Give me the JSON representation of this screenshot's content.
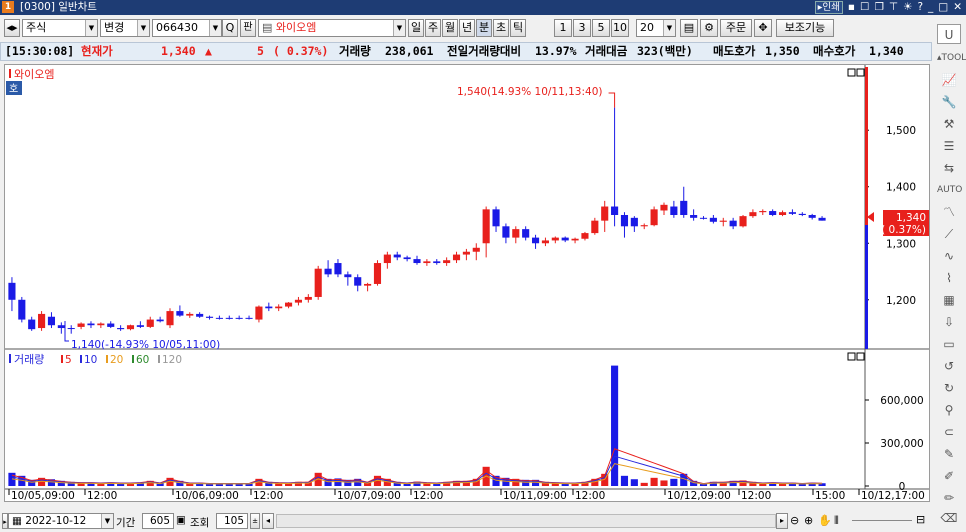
{
  "titlebar": {
    "app_icon": "1",
    "title": "[0300] 일반차트",
    "link": "▸인쇄",
    "icons": [
      "pin-icon",
      "window-icon",
      "window-icon",
      "pin-icon",
      "star-icon",
      "help-icon",
      "minimize-icon",
      "maximize-icon",
      "close-icon"
    ]
  },
  "toolbar": {
    "market": "주식",
    "change_label": "변경",
    "code": "066430",
    "search": "Q",
    "pan_label": "판",
    "stock_name": "와이오엠",
    "periods": [
      "일",
      "주",
      "월",
      "년",
      "분",
      "초",
      "틱"
    ],
    "active_period": "분",
    "minutes": [
      "1",
      "3",
      "5",
      "10"
    ],
    "count": "20",
    "order_label": "주문",
    "aux_label": "보조기능"
  },
  "pricebar": {
    "time": "[15:30:08]",
    "cur_label": "현재가",
    "price": "1,340",
    "arrow": "▲",
    "change": "5",
    "change_pct": "( 0.37%)",
    "vol_label": "거래량",
    "volume": "238,061",
    "prev_label": "전일거래량대비",
    "prev_ratio": "13.97%",
    "amt_label": "거래대금",
    "amount": "323(백만)",
    "ask_label": "매도호가",
    "ask": "1,350",
    "bid_label": "매수호가",
    "bid": "1,340"
  },
  "chart": {
    "title": "와이오엠",
    "badge": "호",
    "high_annotation": "1,540(14.93% 10/11,13:40)",
    "low_annotation": "1,140(-14.93% 10/05,11:00)",
    "price_ticks": [
      "1,500",
      "1,400",
      "1,300",
      "1,200"
    ],
    "current_price_label": "1,340",
    "current_pct_label": "( 0.37%)",
    "volume_legend": {
      "label": "거래량",
      "ma": [
        {
          "n": "5",
          "color": "#e8201c"
        },
        {
          "n": "10",
          "color": "#2a2adc"
        },
        {
          "n": "20",
          "color": "#e89c1e"
        },
        {
          "n": "60",
          "color": "#2e8b2e"
        },
        {
          "n": "120",
          "color": "#999999"
        }
      ]
    },
    "volume_ticks": [
      "600,000",
      "300,000",
      "0"
    ],
    "x_labels": [
      "10/05,09:00",
      "12:00",
      "10/06,09:00",
      "12:00",
      "10/07,09:00",
      "12:00",
      "10/11,09:00",
      "12:00",
      "10/12,09:00",
      "12:00",
      "15:00",
      "10/12,17:00"
    ],
    "colors": {
      "up": "#e8201c",
      "down": "#1a1ae6",
      "flat": "#1a1ae6"
    }
  },
  "chart_data": {
    "type": "candlestick",
    "title": "와이오엠",
    "ylim": [
      1120,
      1580
    ],
    "series": [
      {
        "o": 1230,
        "h": 1240,
        "l": 1180,
        "c": 1200
      },
      {
        "o": 1200,
        "h": 1205,
        "l": 1160,
        "c": 1165
      },
      {
        "o": 1165,
        "h": 1170,
        "l": 1145,
        "c": 1148
      },
      {
        "o": 1150,
        "h": 1180,
        "l": 1145,
        "c": 1175
      },
      {
        "o": 1170,
        "h": 1178,
        "l": 1150,
        "c": 1155
      },
      {
        "o": 1155,
        "h": 1160,
        "l": 1140,
        "c": 1150
      },
      {
        "o": 1150,
        "h": 1155,
        "l": 1140,
        "c": 1150
      },
      {
        "o": 1152,
        "h": 1160,
        "l": 1148,
        "c": 1158
      },
      {
        "o": 1158,
        "h": 1162,
        "l": 1150,
        "c": 1155
      },
      {
        "o": 1155,
        "h": 1160,
        "l": 1150,
        "c": 1158
      },
      {
        "o": 1158,
        "h": 1162,
        "l": 1150,
        "c": 1152
      },
      {
        "o": 1150,
        "h": 1155,
        "l": 1145,
        "c": 1148
      },
      {
        "o": 1148,
        "h": 1156,
        "l": 1146,
        "c": 1155
      },
      {
        "o": 1155,
        "h": 1162,
        "l": 1150,
        "c": 1152
      },
      {
        "o": 1152,
        "h": 1170,
        "l": 1150,
        "c": 1165
      },
      {
        "o": 1165,
        "h": 1170,
        "l": 1160,
        "c": 1162
      },
      {
        "o": 1155,
        "h": 1185,
        "l": 1150,
        "c": 1180
      },
      {
        "o": 1180,
        "h": 1190,
        "l": 1170,
        "c": 1172
      },
      {
        "o": 1172,
        "h": 1178,
        "l": 1168,
        "c": 1175
      },
      {
        "o": 1175,
        "h": 1178,
        "l": 1168,
        "c": 1170
      },
      {
        "o": 1170,
        "h": 1172,
        "l": 1165,
        "c": 1168
      },
      {
        "o": 1168,
        "h": 1172,
        "l": 1165,
        "c": 1168
      },
      {
        "o": 1168,
        "h": 1172,
        "l": 1165,
        "c": 1168
      },
      {
        "o": 1168,
        "h": 1172,
        "l": 1165,
        "c": 1168
      },
      {
        "o": 1168,
        "h": 1172,
        "l": 1165,
        "c": 1168
      },
      {
        "o": 1165,
        "h": 1190,
        "l": 1160,
        "c": 1188
      },
      {
        "o": 1188,
        "h": 1195,
        "l": 1180,
        "c": 1185
      },
      {
        "o": 1185,
        "h": 1192,
        "l": 1180,
        "c": 1188
      },
      {
        "o": 1188,
        "h": 1196,
        "l": 1185,
        "c": 1195
      },
      {
        "o": 1195,
        "h": 1205,
        "l": 1190,
        "c": 1200
      },
      {
        "o": 1200,
        "h": 1210,
        "l": 1195,
        "c": 1205
      },
      {
        "o": 1205,
        "h": 1260,
        "l": 1200,
        "c": 1255
      },
      {
        "o": 1255,
        "h": 1270,
        "l": 1240,
        "c": 1245
      },
      {
        "o": 1265,
        "h": 1272,
        "l": 1240,
        "c": 1245
      },
      {
        "o": 1245,
        "h": 1250,
        "l": 1225,
        "c": 1240
      },
      {
        "o": 1240,
        "h": 1245,
        "l": 1215,
        "c": 1225
      },
      {
        "o": 1225,
        "h": 1230,
        "l": 1215,
        "c": 1228
      },
      {
        "o": 1228,
        "h": 1270,
        "l": 1225,
        "c": 1265
      },
      {
        "o": 1265,
        "h": 1285,
        "l": 1255,
        "c": 1280
      },
      {
        "o": 1280,
        "h": 1285,
        "l": 1270,
        "c": 1275
      },
      {
        "o": 1275,
        "h": 1278,
        "l": 1268,
        "c": 1272
      },
      {
        "o": 1272,
        "h": 1278,
        "l": 1262,
        "c": 1265
      },
      {
        "o": 1265,
        "h": 1272,
        "l": 1260,
        "c": 1268
      },
      {
        "o": 1268,
        "h": 1272,
        "l": 1262,
        "c": 1265
      },
      {
        "o": 1265,
        "h": 1275,
        "l": 1260,
        "c": 1270
      },
      {
        "o": 1270,
        "h": 1285,
        "l": 1265,
        "c": 1280
      },
      {
        "o": 1280,
        "h": 1290,
        "l": 1270,
        "c": 1285
      },
      {
        "o": 1285,
        "h": 1300,
        "l": 1270,
        "c": 1292
      },
      {
        "o": 1300,
        "h": 1365,
        "l": 1275,
        "c": 1360
      },
      {
        "o": 1360,
        "h": 1365,
        "l": 1320,
        "c": 1330
      },
      {
        "o": 1330,
        "h": 1335,
        "l": 1300,
        "c": 1310
      },
      {
        "o": 1310,
        "h": 1330,
        "l": 1300,
        "c": 1325
      },
      {
        "o": 1325,
        "h": 1330,
        "l": 1305,
        "c": 1310
      },
      {
        "o": 1310,
        "h": 1315,
        "l": 1290,
        "c": 1300
      },
      {
        "o": 1300,
        "h": 1310,
        "l": 1295,
        "c": 1305
      },
      {
        "o": 1305,
        "h": 1312,
        "l": 1300,
        "c": 1310
      },
      {
        "o": 1310,
        "h": 1312,
        "l": 1302,
        "c": 1305
      },
      {
        "o": 1305,
        "h": 1310,
        "l": 1300,
        "c": 1308
      },
      {
        "o": 1308,
        "h": 1320,
        "l": 1305,
        "c": 1318
      },
      {
        "o": 1318,
        "h": 1345,
        "l": 1315,
        "c": 1340
      },
      {
        "o": 1340,
        "h": 1375,
        "l": 1320,
        "c": 1365
      },
      {
        "o": 1365,
        "h": 1540,
        "l": 1330,
        "c": 1350
      },
      {
        "o": 1350,
        "h": 1355,
        "l": 1310,
        "c": 1330
      },
      {
        "o": 1345,
        "h": 1348,
        "l": 1320,
        "c": 1330
      },
      {
        "o": 1330,
        "h": 1335,
        "l": 1325,
        "c": 1332
      },
      {
        "o": 1332,
        "h": 1365,
        "l": 1330,
        "c": 1360
      },
      {
        "o": 1358,
        "h": 1372,
        "l": 1350,
        "c": 1368
      },
      {
        "o": 1365,
        "h": 1375,
        "l": 1345,
        "c": 1350
      },
      {
        "o": 1375,
        "h": 1400,
        "l": 1345,
        "c": 1350
      },
      {
        "o": 1350,
        "h": 1360,
        "l": 1340,
        "c": 1345
      },
      {
        "o": 1345,
        "h": 1348,
        "l": 1342,
        "c": 1345
      },
      {
        "o": 1345,
        "h": 1350,
        "l": 1335,
        "c": 1338
      },
      {
        "o": 1338,
        "h": 1345,
        "l": 1330,
        "c": 1340
      },
      {
        "o": 1340,
        "h": 1345,
        "l": 1325,
        "c": 1330
      },
      {
        "o": 1330,
        "h": 1350,
        "l": 1328,
        "c": 1348
      },
      {
        "o": 1348,
        "h": 1360,
        "l": 1345,
        "c": 1355
      },
      {
        "o": 1355,
        "h": 1360,
        "l": 1350,
        "c": 1357
      },
      {
        "o": 1357,
        "h": 1360,
        "l": 1348,
        "c": 1350
      },
      {
        "o": 1350,
        "h": 1358,
        "l": 1348,
        "c": 1355
      },
      {
        "o": 1355,
        "h": 1360,
        "l": 1350,
        "c": 1352
      },
      {
        "o": 1352,
        "h": 1355,
        "l": 1348,
        "c": 1350
      },
      {
        "o": 1350,
        "h": 1352,
        "l": 1342,
        "c": 1345
      },
      {
        "o": 1345,
        "h": 1348,
        "l": 1340,
        "c": 1340
      }
    ],
    "volume_peak": 840000,
    "volume_ylim": [
      0,
      900000
    ]
  },
  "bottom": {
    "date": "2022-10-12",
    "period_label": "기간",
    "period_value": "605",
    "lookup_label": "조회",
    "lookup_value": "105"
  }
}
